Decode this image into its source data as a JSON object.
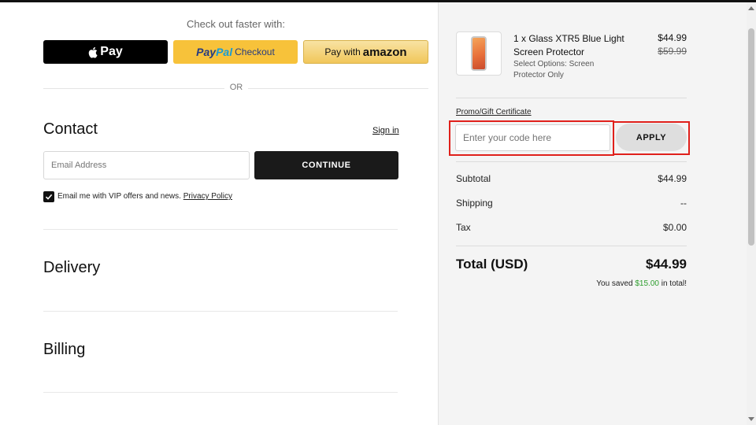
{
  "express": {
    "title": "Check out faster with:",
    "apple_pay_label": "Pay",
    "paypal_brand_a": "Pay",
    "paypal_brand_b": "Pal",
    "paypal_label": "Checkout",
    "amazon_label": "Pay with",
    "amazon_brand": "amazon",
    "or_label": "OR"
  },
  "contact": {
    "title": "Contact",
    "sign_in": "Sign in",
    "email_placeholder": "Email Address",
    "continue_label": "CONTINUE",
    "vip_text": "Email me with VIP offers and news.",
    "privacy_link": "Privacy Policy"
  },
  "delivery": {
    "title": "Delivery"
  },
  "billing": {
    "title": "Billing"
  },
  "cart": {
    "item": {
      "name": "1 x Glass XTR5 Blue Light Screen Protector",
      "options": "Select Options: Screen Protector Only",
      "price": "$44.99",
      "original_price": "$59.99"
    },
    "promo": {
      "label": "Promo/Gift Certificate",
      "placeholder": "Enter your code here",
      "apply_label": "APPLY"
    },
    "summary": {
      "subtotal_label": "Subtotal",
      "subtotal": "$44.99",
      "shipping_label": "Shipping",
      "shipping": "--",
      "tax_label": "Tax",
      "tax": "$0.00",
      "total_label": "Total (USD)",
      "total": "$44.99",
      "saved_prefix": "You saved",
      "saved_amount": "$15.00",
      "saved_suffix": "in total!"
    }
  },
  "colors": {
    "highlight_box": "#e0201b",
    "savings_green": "#2e9e2e",
    "paypal_yellow": "#f7c23a"
  }
}
